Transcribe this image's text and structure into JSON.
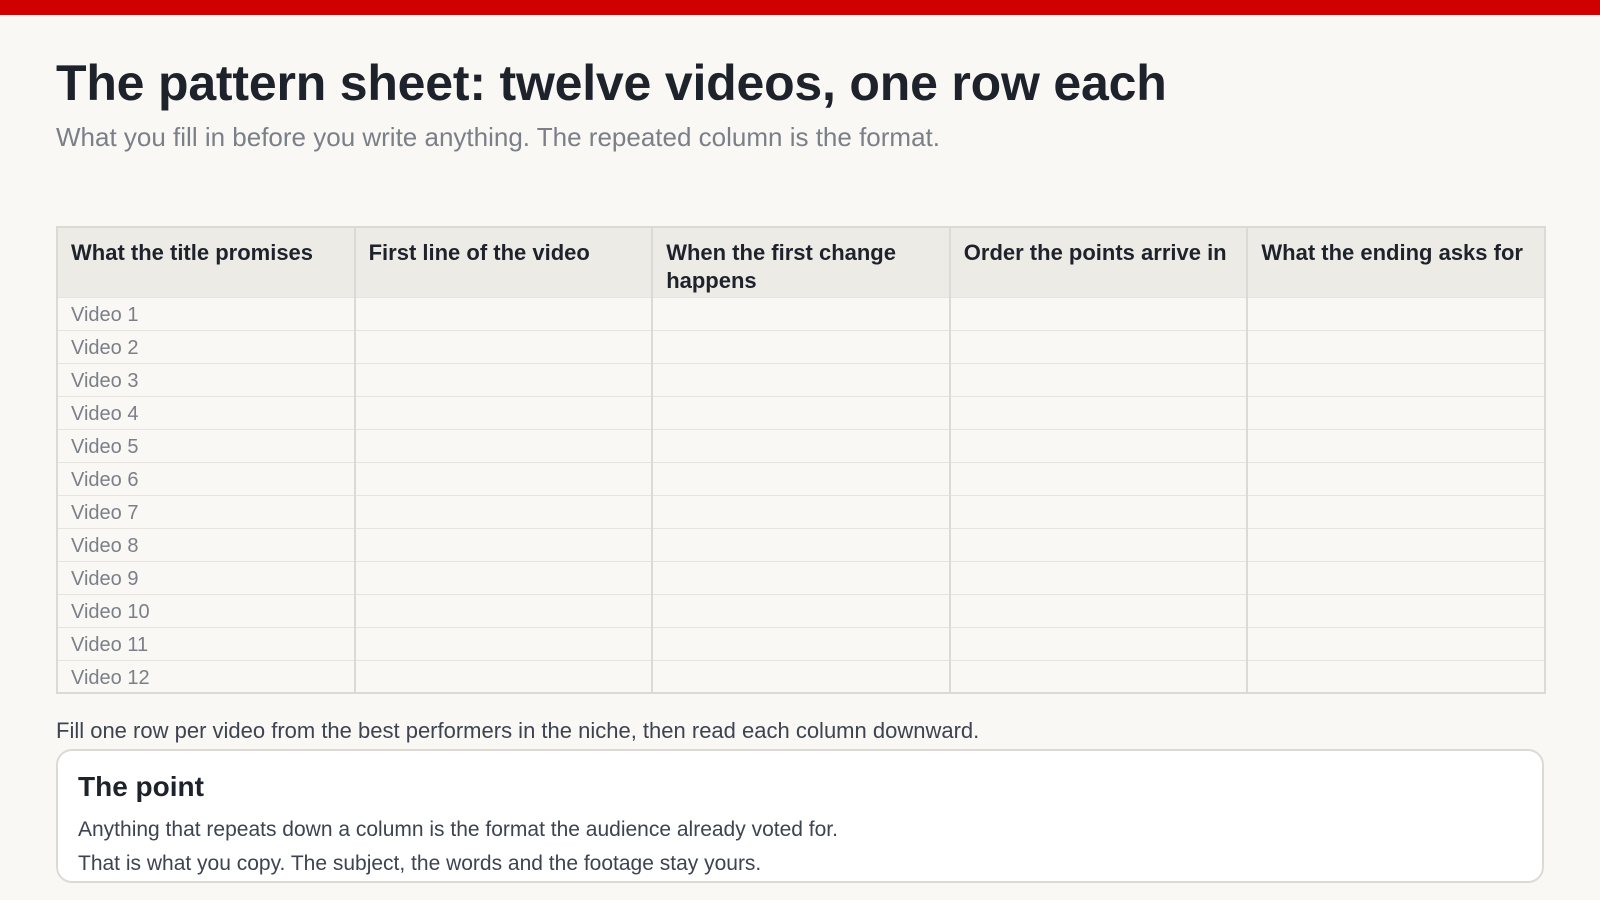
{
  "colors": {
    "accent": "#d00000",
    "background": "#f9f8f5",
    "header_fill": "#ecebe6"
  },
  "page": {
    "title": "The pattern sheet: twelve videos, one row each",
    "subtitle": "What you fill in before you write anything. The repeated column is the format."
  },
  "sheet": {
    "columns": [
      "What the title promises",
      "First line of the video",
      "When the first change happens",
      "Order the points arrive in",
      "What the ending asks for"
    ],
    "rows": [
      "Video 1",
      "Video 2",
      "Video 3",
      "Video 4",
      "Video 5",
      "Video 6",
      "Video 7",
      "Video 8",
      "Video 9",
      "Video 10",
      "Video 11",
      "Video 12"
    ]
  },
  "note": "Fill one row per video from the best performers in the niche, then read each column downward.",
  "point": {
    "title": "The point",
    "lines": [
      "Anything that repeats down a column is the format the audience already voted for.",
      "That is what you copy. The subject, the words and the footage stay yours."
    ]
  }
}
